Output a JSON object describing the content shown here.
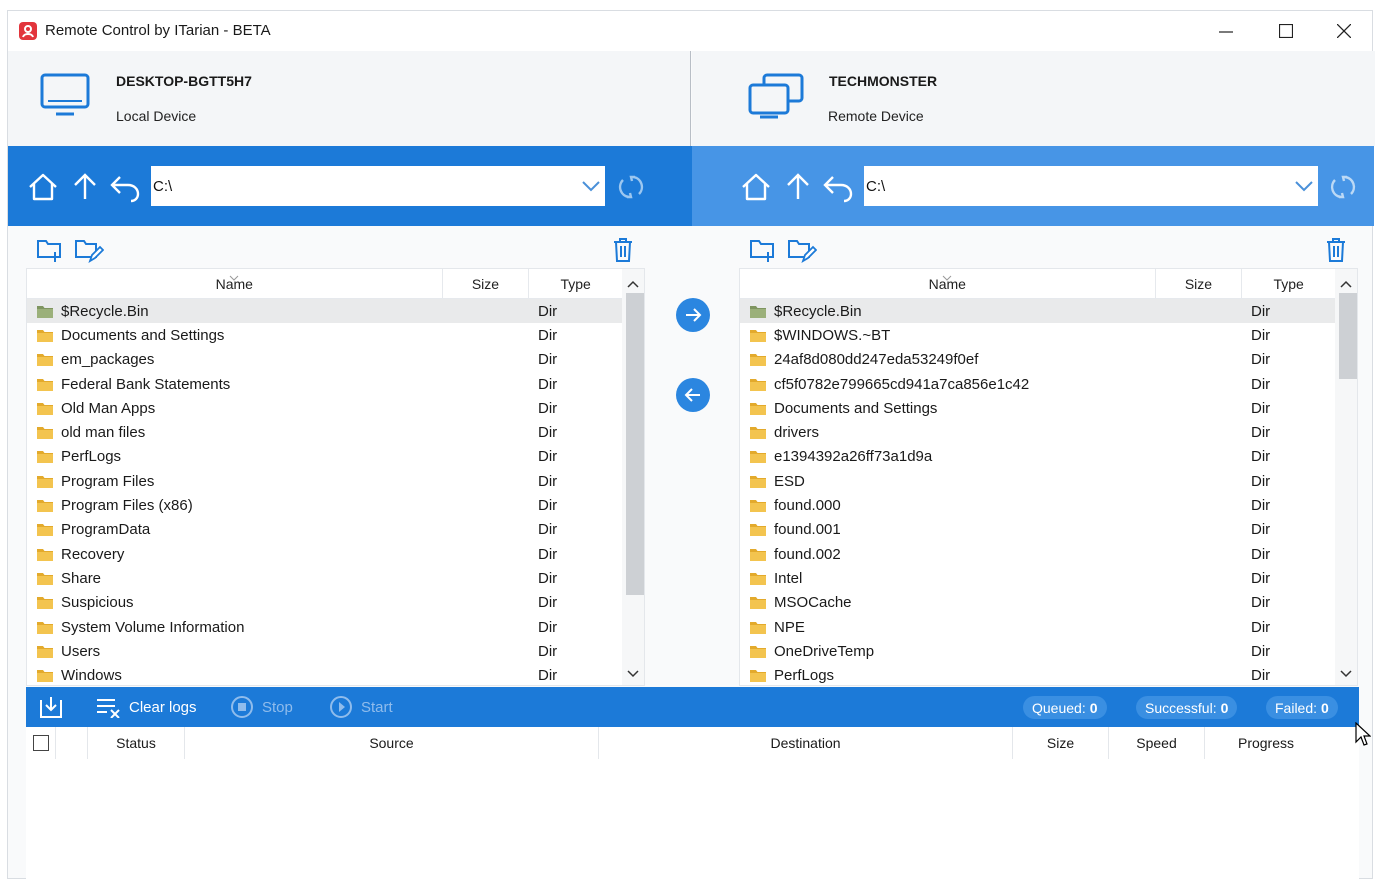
{
  "window": {
    "title": "Remote Control by ITarian - BETA"
  },
  "local": {
    "device_name": "DESKTOP-BGTT5H7",
    "device_role": "Local Device",
    "path": "C:\\",
    "columns": {
      "name": "Name",
      "size": "Size",
      "type": "Type"
    },
    "files": [
      {
        "name": "$Recycle.Bin",
        "type": "Dir"
      },
      {
        "name": "Documents and Settings",
        "type": "Dir"
      },
      {
        "name": "em_packages",
        "type": "Dir"
      },
      {
        "name": "Federal Bank Statements",
        "type": "Dir"
      },
      {
        "name": "Old Man Apps",
        "type": "Dir"
      },
      {
        "name": "old man files",
        "type": "Dir"
      },
      {
        "name": "PerfLogs",
        "type": "Dir"
      },
      {
        "name": "Program Files",
        "type": "Dir"
      },
      {
        "name": "Program Files (x86)",
        "type": "Dir"
      },
      {
        "name": "ProgramData",
        "type": "Dir"
      },
      {
        "name": "Recovery",
        "type": "Dir"
      },
      {
        "name": "Share",
        "type": "Dir"
      },
      {
        "name": "Suspicious",
        "type": "Dir"
      },
      {
        "name": "System Volume Information",
        "type": "Dir"
      },
      {
        "name": "Users",
        "type": "Dir"
      },
      {
        "name": "Windows",
        "type": "Dir"
      }
    ]
  },
  "remote": {
    "device_name": "TECHMONSTER",
    "device_role": "Remote Device",
    "path": "C:\\",
    "columns": {
      "name": "Name",
      "size": "Size",
      "type": "Type"
    },
    "files": [
      {
        "name": "$Recycle.Bin",
        "type": "Dir"
      },
      {
        "name": "$WINDOWS.~BT",
        "type": "Dir"
      },
      {
        "name": "24af8d080dd247eda53249f0ef",
        "type": "Dir"
      },
      {
        "name": "cf5f0782e799665cd941a7ca856e1c42",
        "type": "Dir"
      },
      {
        "name": "Documents and Settings",
        "type": "Dir"
      },
      {
        "name": "drivers",
        "type": "Dir"
      },
      {
        "name": "e1394392a26ff73a1d9a",
        "type": "Dir"
      },
      {
        "name": "ESD",
        "type": "Dir"
      },
      {
        "name": "found.000",
        "type": "Dir"
      },
      {
        "name": "found.001",
        "type": "Dir"
      },
      {
        "name": "found.002",
        "type": "Dir"
      },
      {
        "name": "Intel",
        "type": "Dir"
      },
      {
        "name": "MSOCache",
        "type": "Dir"
      },
      {
        "name": "NPE",
        "type": "Dir"
      },
      {
        "name": "OneDriveTemp",
        "type": "Dir"
      },
      {
        "name": "PerfLogs",
        "type": "Dir"
      }
    ]
  },
  "transfer_log": {
    "clear_logs": "Clear logs",
    "stop": "Stop",
    "start": "Start",
    "queued_label": "Queued:",
    "queued_count": "0",
    "successful_label": "Successful:",
    "successful_count": "0",
    "failed_label": "Failed:",
    "failed_count": "0",
    "columns": {
      "status": "Status",
      "source": "Source",
      "destination": "Destination",
      "size": "Size",
      "speed": "Speed",
      "progress": "Progress"
    }
  },
  "colors": {
    "accent": "#1c7ad8",
    "accent_light": "#4795e6",
    "app_icon": "#e2353c",
    "folder": "#f3c44f"
  }
}
